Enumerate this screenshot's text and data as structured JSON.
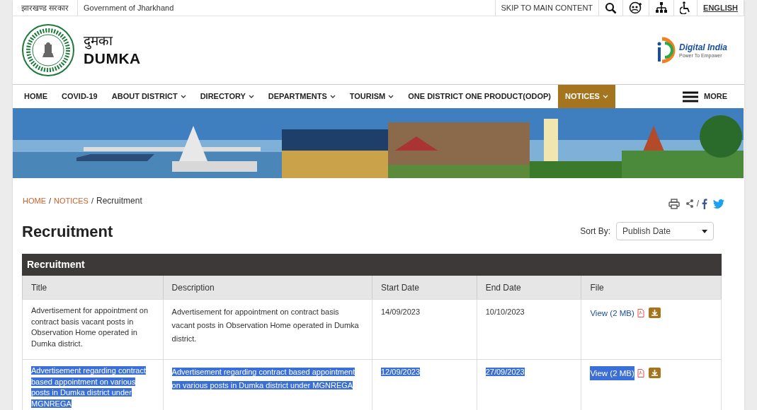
{
  "top_bar": {
    "state_name": "झारखण्ड सरकार",
    "government": "Government of Jharkhand",
    "skip_link": "SKIP TO MAIN CONTENT",
    "language": "ENGLISH"
  },
  "header": {
    "title_hindi": "दुमका",
    "title": "DUMKA",
    "partner_logo": {
      "name": "Digital India",
      "tagline": "Power To Empower"
    }
  },
  "nav": [
    {
      "label": "HOME",
      "dropdown": false,
      "selected": false
    },
    {
      "label": "COVID-19",
      "dropdown": false,
      "selected": false
    },
    {
      "label": "ABOUT DISTRICT",
      "dropdown": true,
      "selected": false
    },
    {
      "label": "DIRECTORY",
      "dropdown": true,
      "selected": false
    },
    {
      "label": "DEPARTMENTS",
      "dropdown": true,
      "selected": false
    },
    {
      "label": "TOURISM",
      "dropdown": true,
      "selected": false
    },
    {
      "label": "ONE DISTRICT ONE PRODUCT(ODOP)",
      "dropdown": false,
      "selected": false
    },
    {
      "label": "NOTICES",
      "dropdown": true,
      "selected": true
    }
  ],
  "more": "MORE",
  "breadcrumb_separator": "/",
  "share_separator": "/",
  "breadcrumb": [
    {
      "label": "HOME",
      "link": true
    },
    {
      "label": "NOTICES",
      "link": true
    },
    {
      "label": "Recruitment",
      "link": false
    }
  ],
  "page_title": "Recruitment",
  "sort": {
    "label": "Sort By:",
    "value": "Publish Date"
  },
  "table": {
    "caption": "Recruitment",
    "columns": [
      "Title",
      "Description",
      "Start Date",
      "End Date",
      "File"
    ],
    "rows": [
      {
        "selected": false,
        "title": "Advertisement for appointment on contract basis vacant posts in Observation Home operated in Dumka district.",
        "description": "Advertisement for appointment on contract basis vacant posts in Observation Home operated in Dumka district.",
        "start_date": "14/09/2023",
        "end_date": "10/10/2023",
        "file": "View (2 MB)"
      },
      {
        "selected": true,
        "title": "Advertisement regarding contract based appointment on various posts in Dumka district under MGNREGA",
        "description": "Advertisement regarding contract based appointment on various posts in Dumka district under MGNREGA",
        "start_date": "12/09/2023",
        "end_date": "27/09/2023",
        "file": "View (2 MB)"
      }
    ]
  }
}
